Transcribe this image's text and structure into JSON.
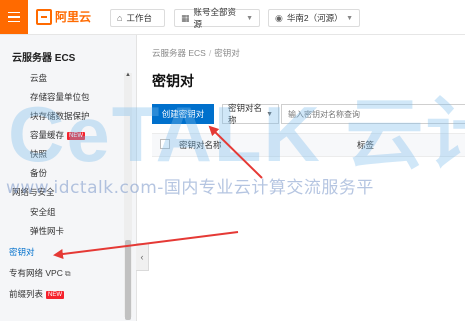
{
  "topbar": {
    "logo_text": "阿里云",
    "workbench": "工作台",
    "resource_group": "账号全部资源",
    "region": "华南2（河源）"
  },
  "sidebar": {
    "title": "云服务器 ECS",
    "items_top": [
      {
        "label": "云盘"
      },
      {
        "label": "存储容量单位包"
      },
      {
        "label": "块存储数据保护"
      },
      {
        "label": "容量缓存"
      },
      {
        "label": "快照"
      },
      {
        "label": "备份"
      }
    ],
    "section": "网络与安全",
    "items_net": [
      {
        "label": "安全组"
      },
      {
        "label": "弹性网卡"
      },
      {
        "label": "密钥对"
      },
      {
        "label": "专有网络 VPC"
      },
      {
        "label": "前缀列表"
      }
    ],
    "new_badge": "NEW"
  },
  "main": {
    "breadcrumb": [
      "云服务器 ECS",
      "密钥对"
    ],
    "title": "密钥对",
    "create_button": "创建密钥对",
    "filter_select": "密钥对名称",
    "search_placeholder": "输入密钥对名称查询",
    "table_headers": [
      "密钥对名称",
      "标签"
    ]
  },
  "watermark": {
    "big": "CeTALK 云计",
    "line": "www.idctalk.com-国内专业云计算交流服务平"
  },
  "colors": {
    "brand_orange": "#ff6a00",
    "primary_blue": "#0070cc",
    "arrow_red": "#e53935",
    "badge_red": "#f5222d"
  }
}
